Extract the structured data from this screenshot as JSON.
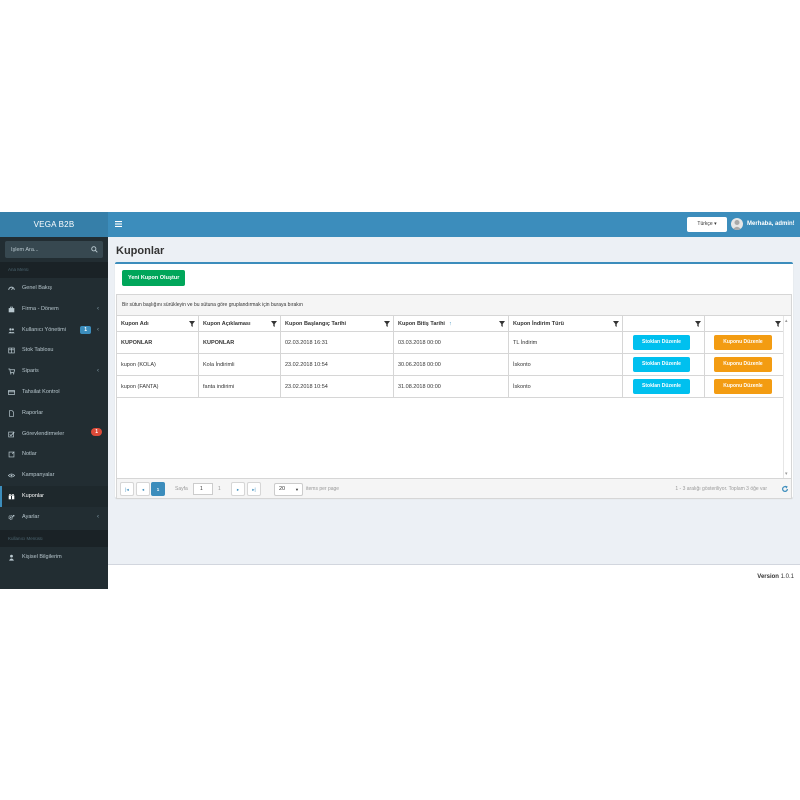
{
  "app": {
    "title": "VEGA B2B"
  },
  "sidebar": {
    "search_placeholder": "İşlem Ara...",
    "main_menu_header": "Ana Menü",
    "items": [
      {
        "label": "Genel Bakış",
        "icon": "dashboard-icon"
      },
      {
        "label": "Firma - Dönem",
        "icon": "briefcase-icon",
        "has_children": true
      },
      {
        "label": "Kullanıcı Yönetimi",
        "icon": "users-icon",
        "has_children": true,
        "badge": "1"
      },
      {
        "label": "Stok Tablosu",
        "icon": "table-icon"
      },
      {
        "label": "Siparis",
        "icon": "cart-icon",
        "has_children": true
      },
      {
        "label": "Tahsilat Kontrol",
        "icon": "credit-card-icon"
      },
      {
        "label": "Raporlar",
        "icon": "file-icon"
      },
      {
        "label": "Görevlendirmeler",
        "icon": "checkbox-icon",
        "badge": "1"
      },
      {
        "label": "Notlar",
        "icon": "note-icon"
      },
      {
        "label": "Kampanyalar",
        "icon": "eye-icon"
      },
      {
        "label": "Kuponlar",
        "icon": "gift-icon",
        "active": true
      },
      {
        "label": "Ayarlar",
        "icon": "cogs-icon",
        "has_children": true
      }
    ],
    "user_menu_header": "Kullanıcı Menüsü",
    "user_items": [
      {
        "label": "Kişisel Bilgilerim",
        "icon": "user-icon"
      }
    ]
  },
  "navbar": {
    "language": "Türkçe ▾",
    "greeting": "Merhaba, admin!"
  },
  "page": {
    "title": "Kuponlar",
    "new_button": "Yeni Kupon Oluştur"
  },
  "grid": {
    "group_hint": "Bir sütun başlığını sürükleyin ve bu sütuna göre gruplandırmak için buraya bırakın",
    "columns": [
      "Kupon Adı",
      "Kupon Açıklaması",
      "Kupon Başlangıç Tarihi",
      "Kupon Bitiş Tarihi",
      "Kupon İndirim Türü",
      "",
      ""
    ],
    "sort_indicator": "↑",
    "rows": [
      {
        "name": "KUPONLAR",
        "description": "KUPONLAR",
        "start": "02.03.2018 16:31",
        "end": "03.03.2018 00:00",
        "type": "TL İndirim"
      },
      {
        "name": "kupon (KOLA)",
        "description": "Kola İndirimli",
        "start": "23.02.2018 10:54",
        "end": "30.06.2018 00:00",
        "type": "İskonto"
      },
      {
        "name": "kupon (FANTA)",
        "description": "fanta indirimi",
        "start": "23.02.2018 10:54",
        "end": "31.08.2018 00:00",
        "type": "İskonto"
      }
    ],
    "row_actions": {
      "stock": "Stokları Düzenle",
      "edit": "Kuponu Düzenle"
    },
    "pager": {
      "first": "|◂",
      "prev": "◂",
      "current": "1",
      "next": "▸",
      "last": "▸|",
      "page_label": "Sayfa",
      "page_value": "1",
      "page_total": "1",
      "page_size": "20",
      "page_size_label": "items per page",
      "info": "1 - 3 aralığı gösteriliyor. Toplam 3 öğe var"
    }
  },
  "footer": {
    "version_label": "Version",
    "version": "1.0.1"
  },
  "colors": {
    "sidebar": "#222d32",
    "primary": "#3c8dbc",
    "success": "#00a65a",
    "info": "#00c0ef",
    "warning": "#f39c12",
    "danger": "#dd4b39"
  }
}
